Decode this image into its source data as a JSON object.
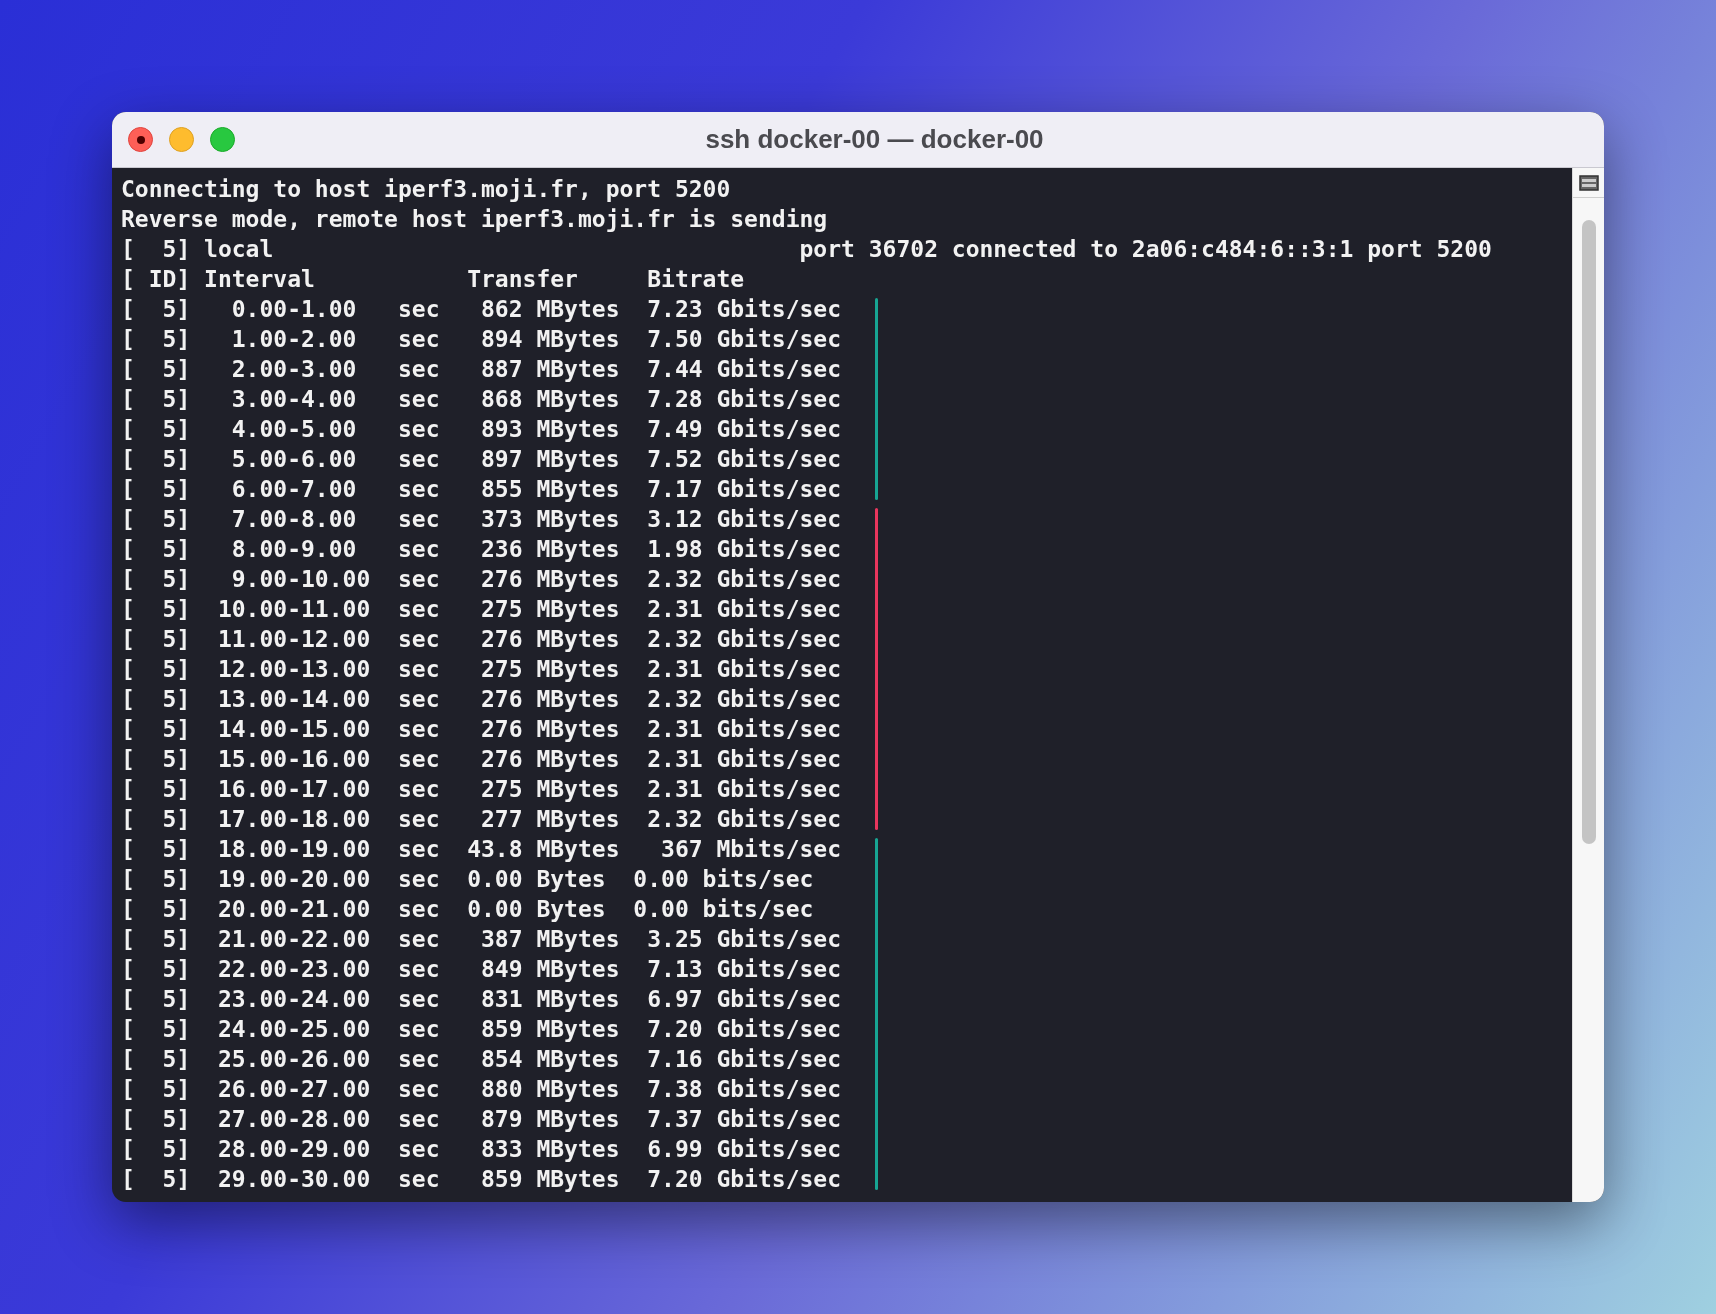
{
  "window": {
    "title": "ssh docker-00 — docker-00"
  },
  "terminal": {
    "header_lines": [
      "Connecting to host iperf3.moji.fr, port 5200",
      "Reverse mode, remote host iperf3.moji.fr is sending",
      "[  5] local                                      port 36702 connected to 2a06:c484:6::3:1 port 5200",
      "[ ID] Interval           Transfer     Bitrate"
    ],
    "groups": [
      {
        "color": "#17a593",
        "lines": [
          "[  5]   0.00-1.00   sec   862 MBytes  7.23 Gbits/sec",
          "[  5]   1.00-2.00   sec   894 MBytes  7.50 Gbits/sec",
          "[  5]   2.00-3.00   sec   887 MBytes  7.44 Gbits/sec",
          "[  5]   3.00-4.00   sec   868 MBytes  7.28 Gbits/sec",
          "[  5]   4.00-5.00   sec   893 MBytes  7.49 Gbits/sec",
          "[  5]   5.00-6.00   sec   897 MBytes  7.52 Gbits/sec",
          "[  5]   6.00-7.00   sec   855 MBytes  7.17 Gbits/sec"
        ]
      },
      {
        "color": "#e8365d",
        "lines": [
          "[  5]   7.00-8.00   sec   373 MBytes  3.12 Gbits/sec",
          "[  5]   8.00-9.00   sec   236 MBytes  1.98 Gbits/sec",
          "[  5]   9.00-10.00  sec   276 MBytes  2.32 Gbits/sec",
          "[  5]  10.00-11.00  sec   275 MBytes  2.31 Gbits/sec",
          "[  5]  11.00-12.00  sec   276 MBytes  2.32 Gbits/sec",
          "[  5]  12.00-13.00  sec   275 MBytes  2.31 Gbits/sec",
          "[  5]  13.00-14.00  sec   276 MBytes  2.32 Gbits/sec",
          "[  5]  14.00-15.00  sec   276 MBytes  2.31 Gbits/sec",
          "[  5]  15.00-16.00  sec   276 MBytes  2.31 Gbits/sec",
          "[  5]  16.00-17.00  sec   275 MBytes  2.31 Gbits/sec",
          "[  5]  17.00-18.00  sec   277 MBytes  2.32 Gbits/sec"
        ]
      },
      {
        "color": "#17a593",
        "lines": [
          "[  5]  18.00-19.00  sec  43.8 MBytes   367 Mbits/sec",
          "[  5]  19.00-20.00  sec  0.00 Bytes  0.00 bits/sec",
          "[  5]  20.00-21.00  sec  0.00 Bytes  0.00 bits/sec",
          "[  5]  21.00-22.00  sec   387 MBytes  3.25 Gbits/sec",
          "[  5]  22.00-23.00  sec   849 MBytes  7.13 Gbits/sec",
          "[  5]  23.00-24.00  sec   831 MBytes  6.97 Gbits/sec",
          "[  5]  24.00-25.00  sec   859 MBytes  7.20 Gbits/sec",
          "[  5]  25.00-26.00  sec   854 MBytes  7.16 Gbits/sec",
          "[  5]  26.00-27.00  sec   880 MBytes  7.38 Gbits/sec",
          "[  5]  27.00-28.00  sec   879 MBytes  7.37 Gbits/sec",
          "[  5]  28.00-29.00  sec   833 MBytes  6.99 Gbits/sec",
          "[  5]  29.00-30.00  sec   859 MBytes  7.20 Gbits/sec"
        ]
      }
    ]
  }
}
